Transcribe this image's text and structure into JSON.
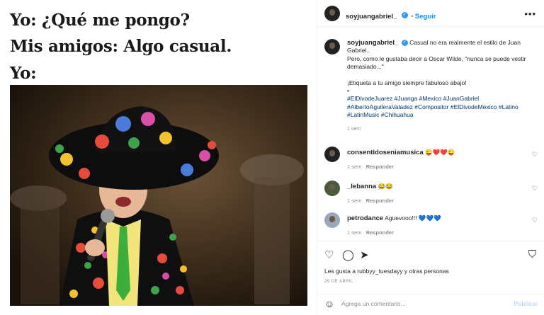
{
  "meme": {
    "line1": "Yo: ¿Qué me pongo?",
    "line2": "Mis amigos: Algo casual.",
    "line3": "Yo:"
  },
  "post": {
    "username": "soyjuangabriel_",
    "follow_label": "Seguir",
    "more_icon": "more-dots-icon",
    "caption_text1": "Casual no era realmente el estilo de Juan Gabriel..",
    "caption_text2": "Pero, como le gustaba decir a Oscar Wilde, \"nunca se puede vestir demasiado...\"",
    "caption_text3": "¡Etiqueta a tu amigo siempre fabuloso abajo!",
    "caption_bullet": "•",
    "hashtags1": "#ElDivodeJuarez #Juanga #Mexico #JuanGabriel",
    "hashtags2": "#AlbertoAguileraValadez #Compositor #ElDivodeMexico #Latino",
    "hashtags3": "#LatinMusic #Chihuahua",
    "caption_time": "1 sem"
  },
  "comments": [
    {
      "user": "consentidoseniamusica",
      "text": "😜❤️❤️😜",
      "time": "1 sem",
      "reply": "Responder"
    },
    {
      "user": "_lebanna",
      "text": "😂😂",
      "time": "1 sem",
      "reply": "Responder"
    },
    {
      "user": "petrodance",
      "text": "Aguevooo!!! 💙💙💙",
      "time": "1 sem",
      "reply": "Responder"
    }
  ],
  "actions": {
    "likes_text": "Les gusta a rubbyy_tuesdayy y otras personas",
    "date": "29 DE ABRIL",
    "comment_placeholder": "Agrega un comentario...",
    "publish_label": "Publicar"
  },
  "colors": {
    "link": "#0095f6",
    "hashtag": "#00376b",
    "muted": "#8e8e8e"
  }
}
